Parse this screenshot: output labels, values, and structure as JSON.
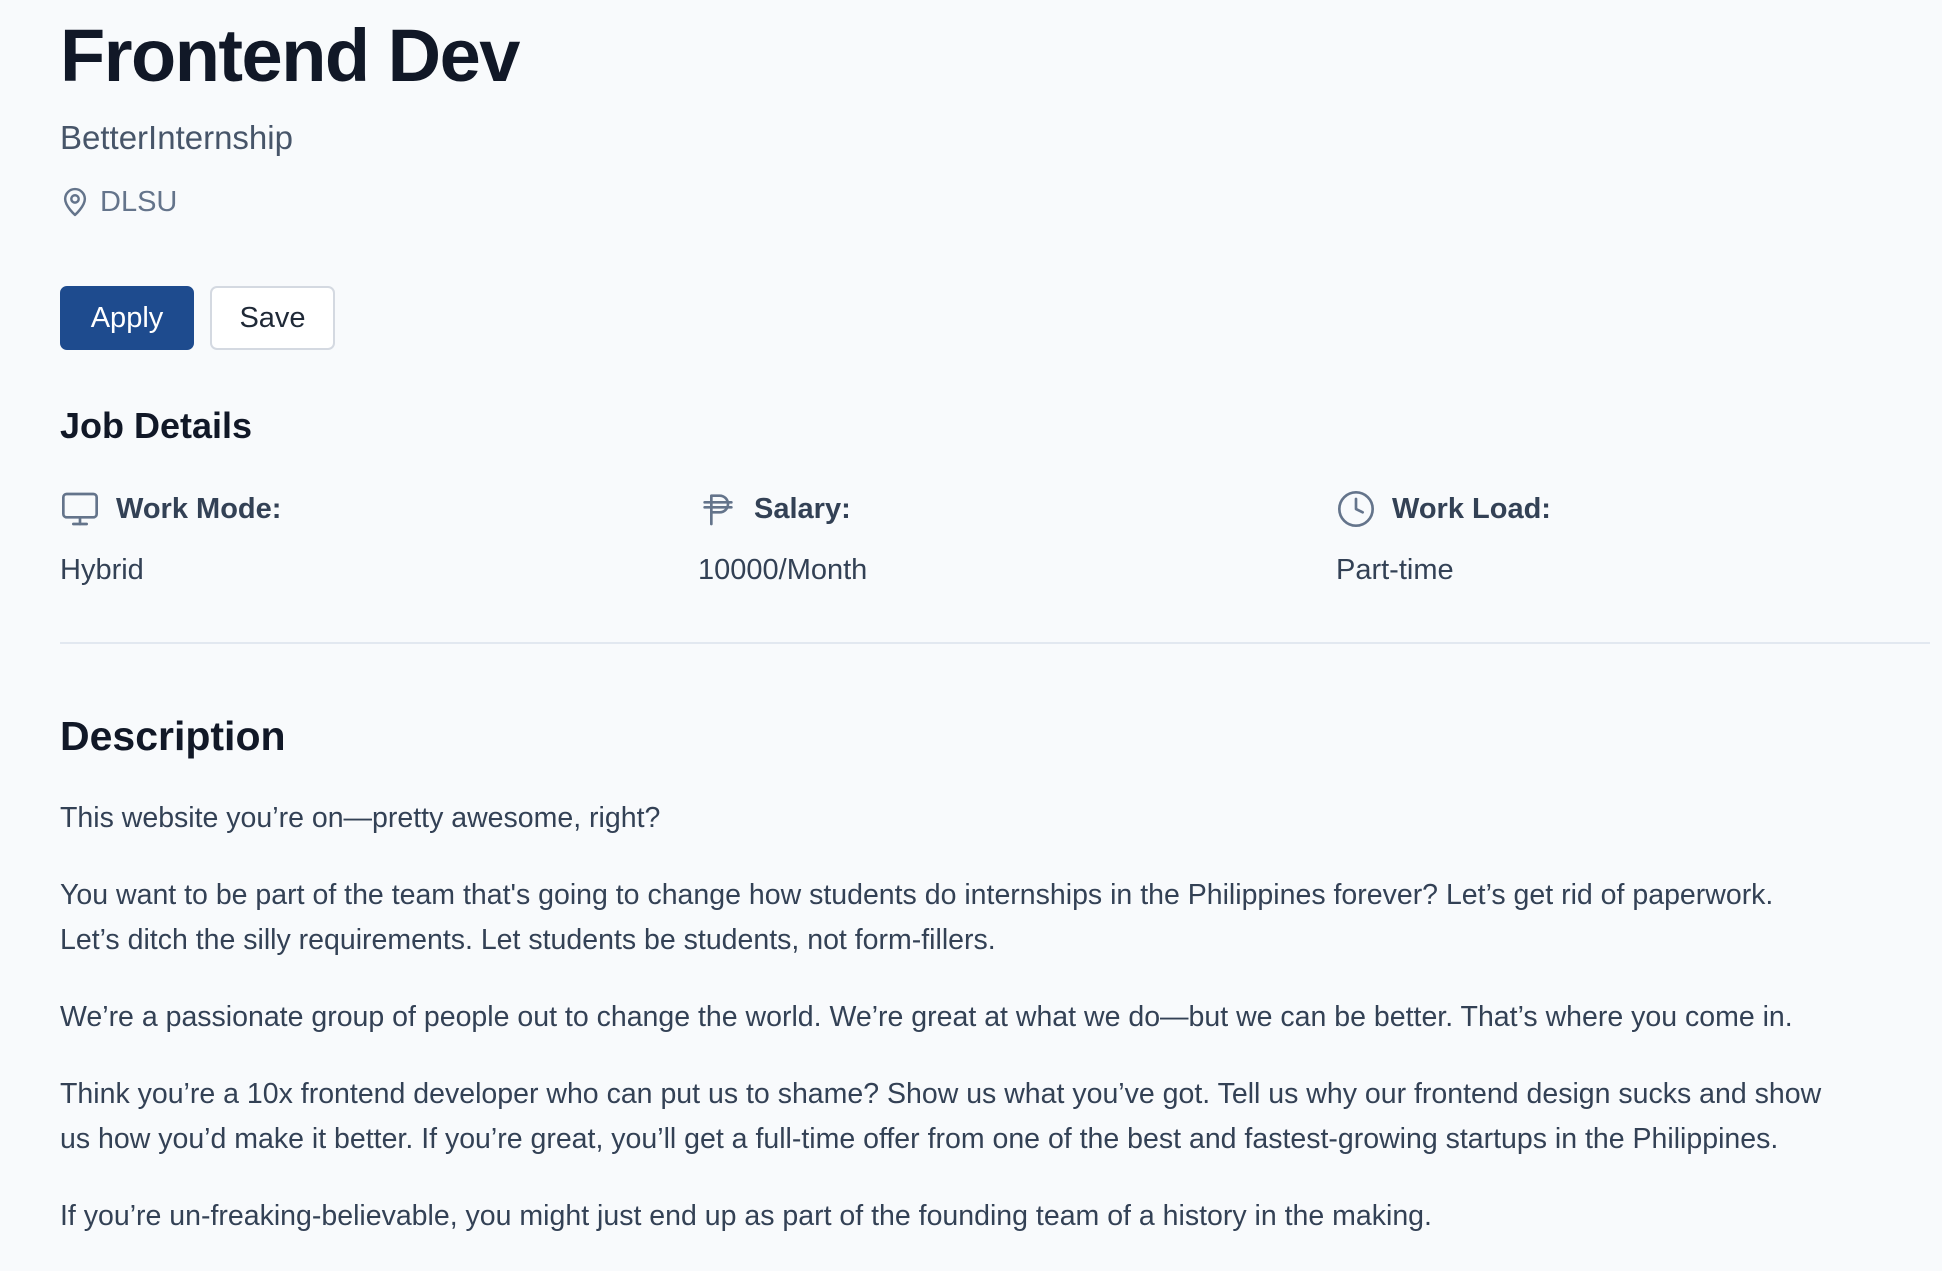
{
  "job": {
    "title": "Frontend Dev",
    "company": "BetterInternship",
    "location": "DLSU",
    "location_icon": "map-pin-icon"
  },
  "actions": {
    "apply_label": "Apply",
    "save_label": "Save"
  },
  "job_details": {
    "heading": "Job Details",
    "items": [
      {
        "icon": "monitor-icon",
        "label": "Work Mode:",
        "value": "Hybrid"
      },
      {
        "icon": "peso-icon",
        "label": "Salary:",
        "value": "10000/Month"
      },
      {
        "icon": "clock-icon",
        "label": "Work Load:",
        "value": "Part-time"
      }
    ]
  },
  "description": {
    "heading": "Description",
    "paragraphs": [
      "This website you’re on—pretty awesome, right?",
      "You want to be part of the team that's going to change how students do internships in the Philippines forever? Let’s get rid of paperwork.\nLet’s ditch the silly requirements. Let students be students, not form-fillers.",
      "We’re a passionate group of people out to change the world. We’re great at what we do—but we can be better. That’s where you come in.",
      "Think you’re a 10x frontend developer who can put us to shame? Show us what you’ve got. Tell us why our frontend design sucks and show\nus how you’d make it better. If you’re great, you’ll get a full-time offer from one of the best and fastest-growing startups in the Philippines.",
      "If you’re un-freaking-believable, you might just end up as part of the founding team of a history in the making."
    ]
  },
  "colors": {
    "background": "#f8fafc",
    "primary_button": "#1e4b8e",
    "heading_text": "#111827",
    "body_text": "#334155",
    "muted_text": "#64748b",
    "divider": "#e2e8f0"
  }
}
